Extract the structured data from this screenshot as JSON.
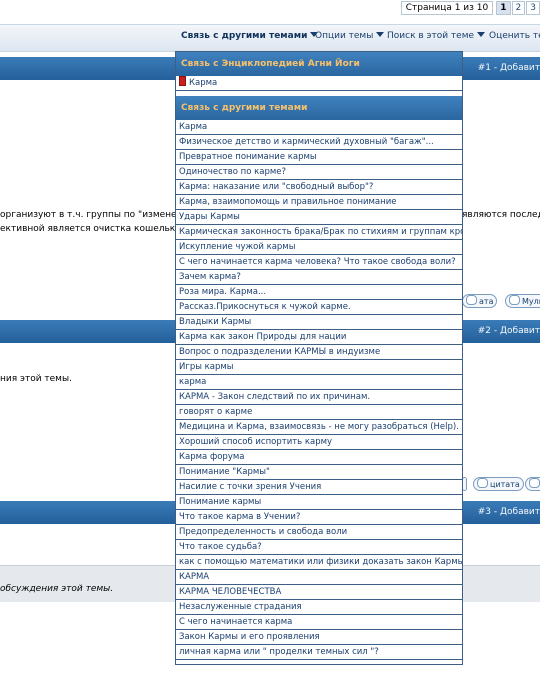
{
  "pagination": {
    "label": "Страница 1 из 10",
    "pages": [
      "1",
      "2",
      "3"
    ],
    "active": "1"
  },
  "toolbar": {
    "links_label": "Связь с другими темами",
    "options_label": "Опции темы",
    "search_label": "Поиск в этой теме",
    "rate_label": "Оценить тем"
  },
  "posts": [
    {
      "id_label": "#1 - Добавит"
    },
    {
      "id_label": "#2 - Добавит"
    },
    {
      "id_label": "#3 - Добавит"
    }
  ],
  "post1": {
    "line1_left": "организуют в т.ч. группы по \"измене",
    "line1_right": "являются послед",
    "line2_left": "ективной является очистка кошельк"
  },
  "post2": {
    "line1": "ния этой темы."
  },
  "post3": {
    "line1": "обсуждения этой темы."
  },
  "buttons": {
    "quote": "цитата",
    "quote_short": "ата",
    "multi": "Мульт"
  },
  "dropdown": {
    "section1_title": "Связь с Энциклопедией Агни Йоги",
    "section1_items": [
      "Карма"
    ],
    "section2_title": "Связь с другими темами",
    "section2_items": [
      "Карма",
      "Физическое детство и кармический духовный \"багаж\"...",
      "Превратное понимание кармы",
      "Одиночество по карме?",
      "Карма: наказание или \"свободный выбор\"?",
      "Карма, взаимопомощь и правильное понимание",
      "Удары Кармы",
      "Кармическая законность брака/Брак по стихиям и группам крови",
      "Искупление чужой кармы",
      "С чего начинается карма человека? Что такое свобода воли?",
      "Зачем карма?",
      "Роза мира. Карма...",
      "Рассказ.Прикоснуться к чужой карме.",
      "Владыки Кармы",
      "Карма как закон Природы для нации",
      "Вопрос о подразделении КАРМЫ в индуизме",
      "Игры кармы",
      "карма",
      "КАРМА - Закон следствий по их причинам.",
      "говорят о карме",
      "Медицина и Карма, взаимосвязь - не могу разобраться (Help).",
      "Хороший способ испортить карму",
      "Карма форума",
      "Понимание \"Кармы\"",
      "Насилие с точки зрения Учения",
      "Понимание кармы",
      "Что такое карма в Учении?",
      "Предопределенность и свобода воли",
      "Что такое судьба?",
      "как с помощью математики или физики доказать закон Кармы?",
      "КАРМА",
      "КАРМА ЧЕЛОВЕЧЕСТВА",
      "Незаслуженные страдания",
      "С чего начинается карма",
      "Закон Кармы и его проявления",
      "личная карма или \" проделки темных сил \"?"
    ]
  }
}
